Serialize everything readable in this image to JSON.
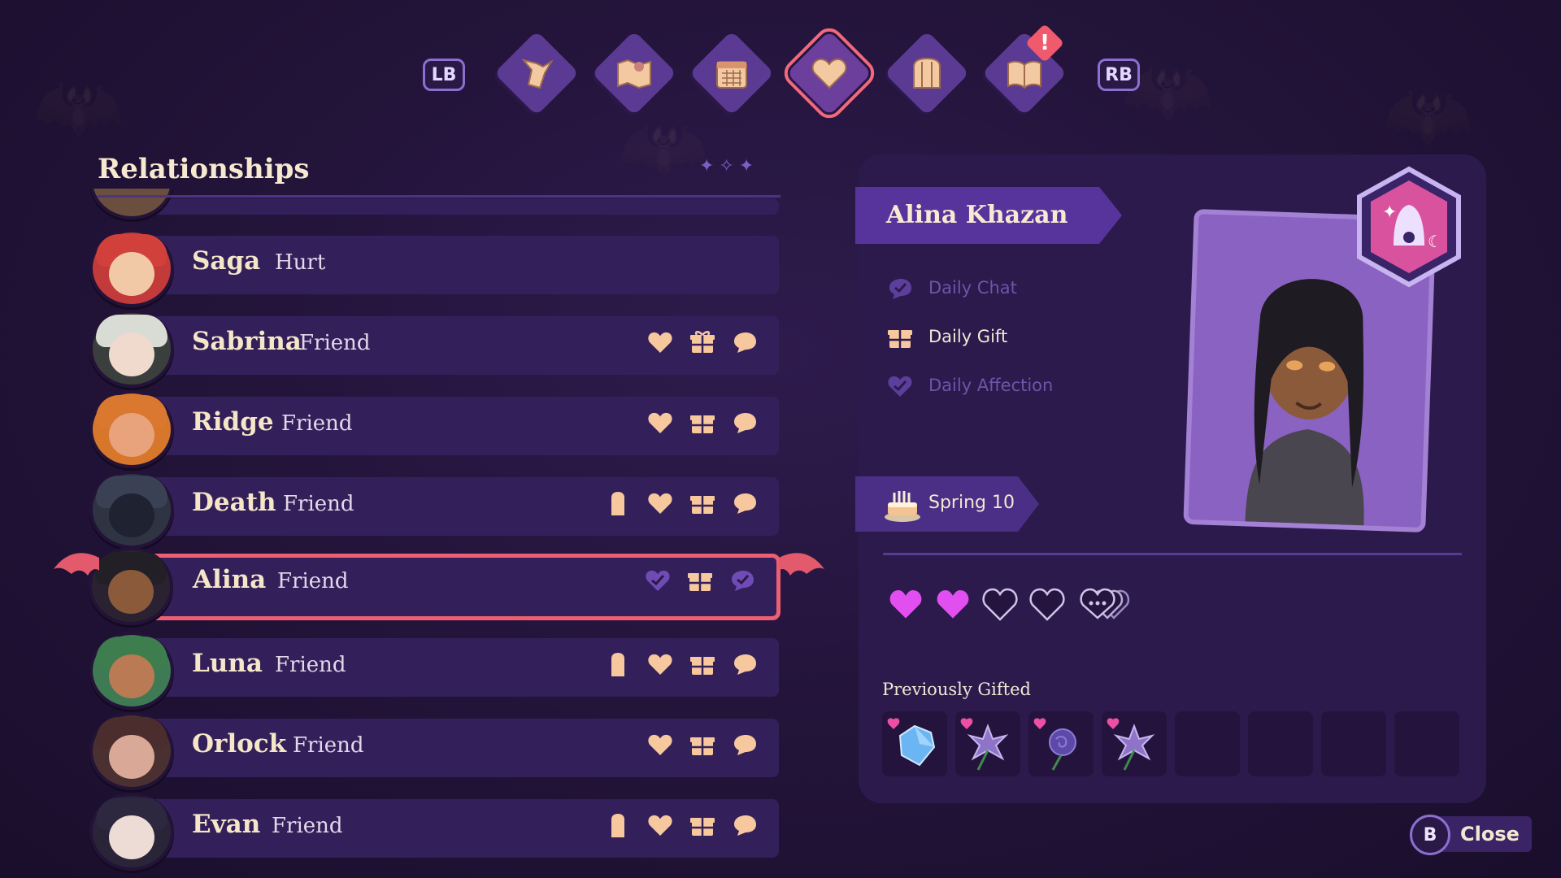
{
  "tabbar": {
    "lb": "LB",
    "rb": "RB",
    "tabs": [
      {
        "icon": "goat-icon"
      },
      {
        "icon": "map-icon"
      },
      {
        "icon": "calendar-icon"
      },
      {
        "icon": "heart-icon",
        "active": true
      },
      {
        "icon": "inventory-icon"
      },
      {
        "icon": "journal-icon",
        "alert": "!"
      }
    ]
  },
  "relationships": {
    "title": "Relationships",
    "rows": [
      {
        "name": "Saga",
        "status": "Hurt",
        "icons": []
      },
      {
        "name": "Sabrina",
        "status": "Friend",
        "icons": [
          "heart-icon",
          "gift-icon",
          "chat-icon"
        ]
      },
      {
        "name": "Ridge",
        "status": "Friend",
        "icons": [
          "heart-icon",
          "gift-icon",
          "chat-icon"
        ]
      },
      {
        "name": "Death",
        "status": "Friend",
        "icons": [
          "tombstone-icon",
          "heart-icon",
          "gift-icon",
          "chat-icon"
        ]
      },
      {
        "name": "Alina",
        "status": "Friend",
        "icons": [
          "heart-check-icon",
          "gift-icon",
          "chat-check-icon"
        ],
        "selected": true
      },
      {
        "name": "Luna",
        "status": "Friend",
        "icons": [
          "tombstone-icon",
          "heart-icon",
          "gift-icon",
          "chat-icon"
        ]
      },
      {
        "name": "Orlock",
        "status": "Friend",
        "icons": [
          "heart-icon",
          "gift-icon",
          "chat-icon"
        ]
      },
      {
        "name": "Evan",
        "status": "Friend",
        "icons": [
          "tombstone-icon",
          "heart-icon",
          "gift-icon",
          "chat-icon"
        ]
      }
    ]
  },
  "detail": {
    "full_name": "Alina Khazan",
    "daily": [
      {
        "label": "Daily Chat",
        "done": true
      },
      {
        "label": "Daily Gift",
        "done": false
      },
      {
        "label": "Daily Affection",
        "done": true
      }
    ],
    "birthday": "Spring 10",
    "hearts_filled": 2,
    "hearts_total": 4,
    "previously_gifted_title": "Previously Gifted",
    "gifts": [
      "blue-gem-icon",
      "violet-flower-icon",
      "purple-rose-icon",
      "violet-flower-icon",
      "",
      "",
      "",
      ""
    ]
  },
  "footer": {
    "button": "B",
    "label": "Close"
  },
  "colors": {
    "accent": "#ef5f73",
    "heart": "#e24ff0",
    "panel": "#2c1a4d"
  }
}
